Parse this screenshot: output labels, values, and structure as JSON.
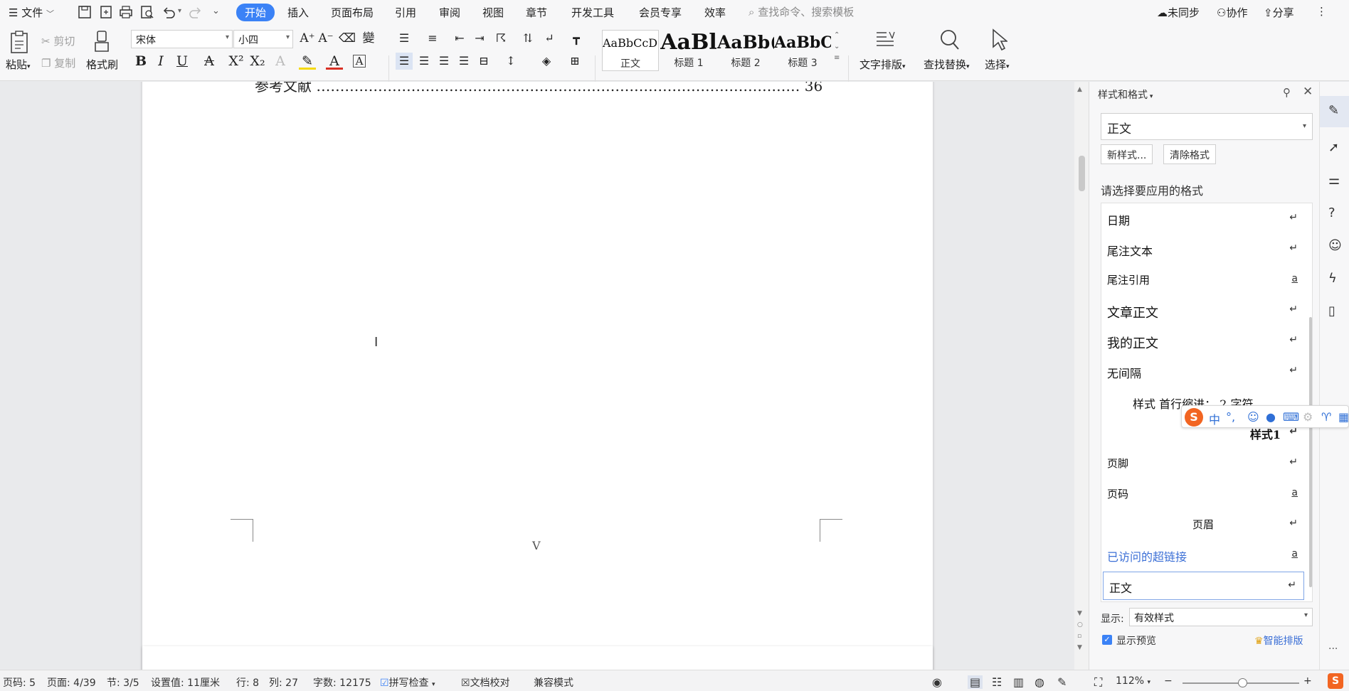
{
  "menubar": {
    "file": "文件",
    "tabs": [
      "开始",
      "插入",
      "页面布局",
      "引用",
      "审阅",
      "视图",
      "章节",
      "开发工具",
      "会员专享",
      "效率"
    ],
    "search_placeholder": "查找命令、搜索模板",
    "sync": "未同步",
    "collab": "协作",
    "share": "分享"
  },
  "ribbon": {
    "paste": "粘贴",
    "cut": "剪切",
    "copy": "复制",
    "format_painter": "格式刷",
    "font_name": "宋体",
    "font_size": "小四",
    "styles": [
      {
        "preview": "AaBbCcDd",
        "name": "正文"
      },
      {
        "preview": "AaBl",
        "name": "标题 1"
      },
      {
        "preview": "AaBb(",
        "name": "标题 2"
      },
      {
        "preview": "AaBbC",
        "name": "标题 3"
      }
    ],
    "text_layout": "文字排版",
    "find_replace": "查找替换",
    "select": "选择"
  },
  "document": {
    "toc_line": "参考文献 ………………………………………………………………………………………… 36",
    "page_number": "V"
  },
  "pane": {
    "title": "样式和格式",
    "current_style": "正文",
    "new_style": "新样式...",
    "clear_format": "清除格式",
    "prompt": "请选择要应用的格式",
    "items": [
      {
        "label": "日期",
        "mark": "↵"
      },
      {
        "label": "尾注文本",
        "mark": "↵"
      },
      {
        "label": "尾注引用",
        "mark": "a"
      },
      {
        "label": "文章正文",
        "mark": "↵"
      },
      {
        "label": "我的正文",
        "mark": "↵"
      },
      {
        "label": "无间隔",
        "mark": "↵"
      },
      {
        "label": "样式 首行缩进： 2 字符",
        "mark": "↵"
      },
      {
        "label": "样式1",
        "mark": "↵"
      },
      {
        "label": "页脚",
        "mark": "↵"
      },
      {
        "label": "页码",
        "mark": "a"
      },
      {
        "label": "页眉",
        "mark": "↵"
      },
      {
        "label": "已访问的超链接",
        "mark": "a"
      },
      {
        "label": "正文",
        "mark": "↵"
      }
    ],
    "show_label": "显示:",
    "show_value": "有效样式",
    "show_preview": "显示预览",
    "smart_layout": "智能排版"
  },
  "ime": {
    "lang": "中",
    "punct": "°,"
  },
  "statusbar": {
    "page_code": "页码: 5",
    "page": "页面: 4/39",
    "section": "节: 3/5",
    "setting": "设置值: 11厘米",
    "row": "行: 8",
    "col": "列: 27",
    "words": "字数: 12175",
    "spell": "拼写检查",
    "proof": "文档校对",
    "compat": "兼容模式",
    "zoom": "112%"
  },
  "colors": {
    "accent": "#3b82f6",
    "link": "#3b6fd6",
    "ime_brand": "#f26522"
  }
}
